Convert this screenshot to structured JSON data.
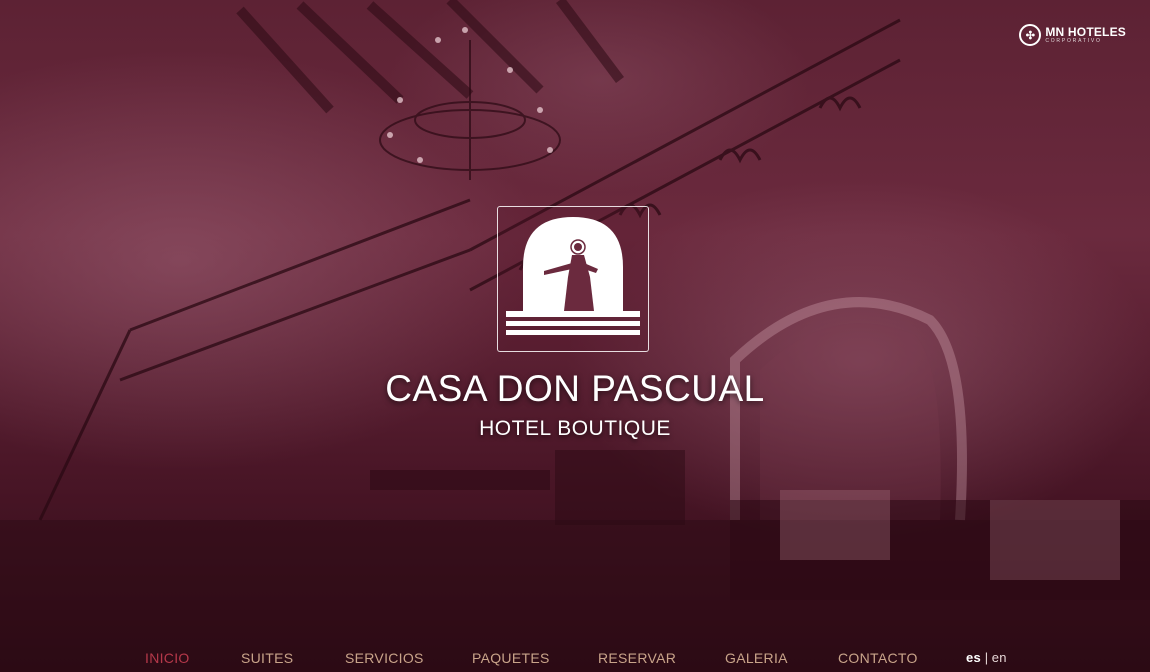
{
  "brand": {
    "icon": "mn-hoteles-logo-icon",
    "name": "MN HOTELES",
    "subtitle": "CORPORATIVO"
  },
  "hero": {
    "title": "CASA DON PASCUAL",
    "subtitle": "HOTEL BOUTIQUE",
    "logo_icon": "saint-figure-arch-logo",
    "overlay_color": "#6b2a3e"
  },
  "nav": {
    "items": [
      {
        "label": "INICIO",
        "active": true
      },
      {
        "label": "SUITES",
        "active": false
      },
      {
        "label": "SERVICIOS",
        "active": false
      },
      {
        "label": "PAQUETES",
        "active": false
      },
      {
        "label": "RESERVAR",
        "active": false
      },
      {
        "label": "GALERIA",
        "active": false
      },
      {
        "label": "CONTACTO",
        "active": false
      }
    ],
    "active_color": "#b5384a",
    "link_color": "#c9a48a"
  },
  "language": {
    "current": "es",
    "separator": "|",
    "other": "en"
  }
}
